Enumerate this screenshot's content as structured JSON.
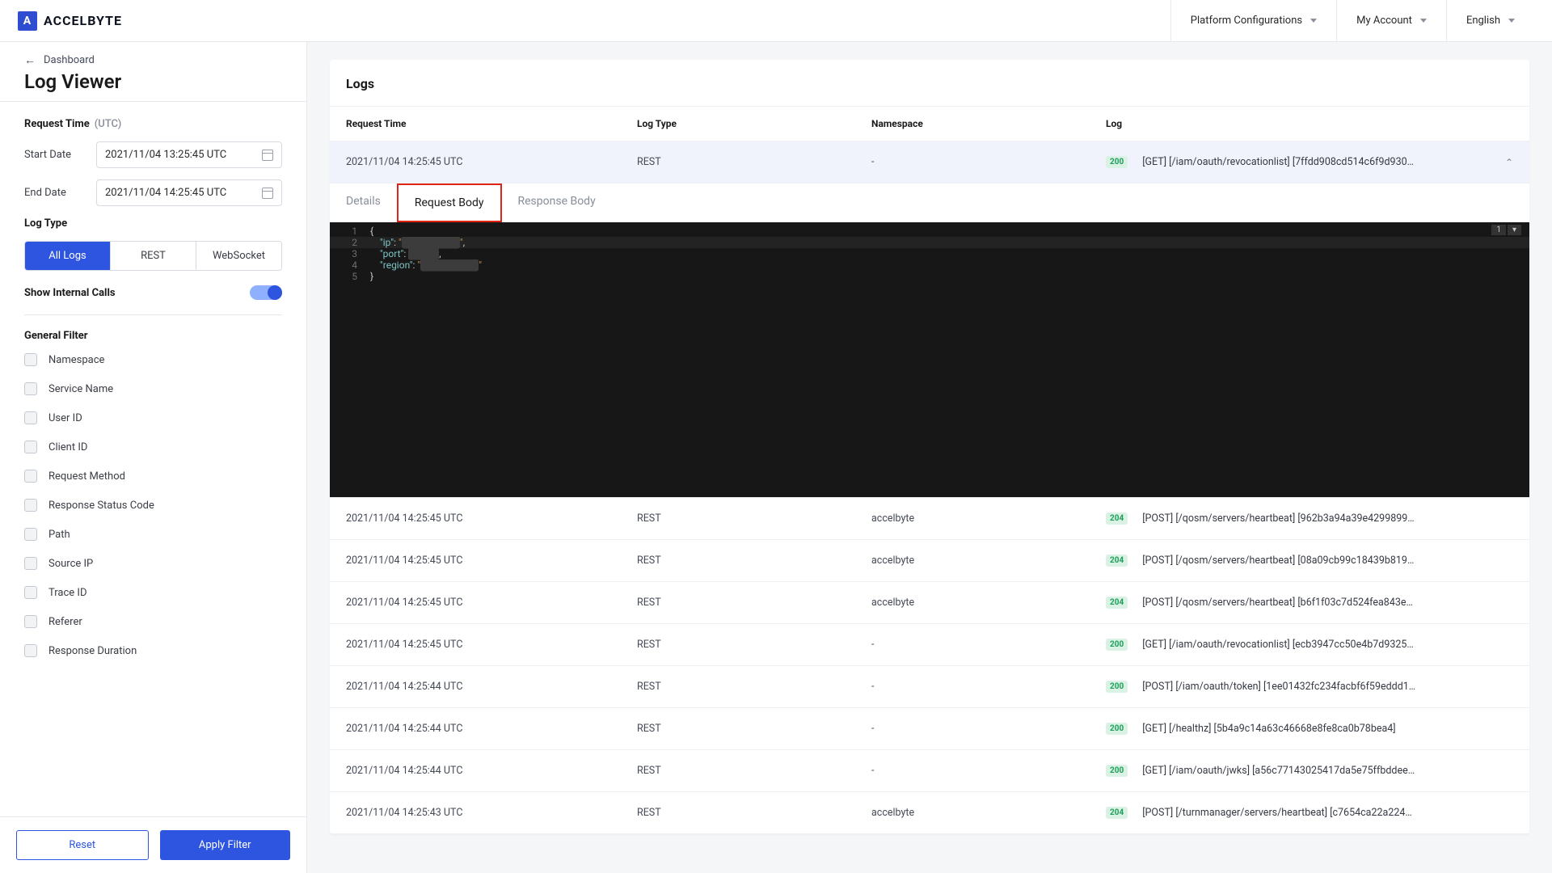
{
  "header": {
    "brand": "ACCELBYTE",
    "platform_config": "Platform Configurations",
    "my_account": "My Account",
    "language": "English"
  },
  "sidebar": {
    "breadcrumb_label": "Dashboard",
    "page_title": "Log Viewer",
    "request_time_label": "Request Time",
    "utc_label": "(UTC)",
    "start_date_label": "Start Date",
    "start_date_value": "2021/11/04 13:25:45 UTC",
    "end_date_label": "End Date",
    "end_date_value": "2021/11/04 14:25:45 UTC",
    "log_type_label": "Log Type",
    "seg_all": "All Logs",
    "seg_rest": "REST",
    "seg_ws": "WebSocket",
    "show_internal_label": "Show Internal Calls",
    "general_filter_label": "General Filter",
    "filters": [
      "Namespace",
      "Service Name",
      "User ID",
      "Client ID",
      "Request Method",
      "Response Status Code",
      "Path",
      "Source IP",
      "Trace ID",
      "Referer",
      "Response Duration"
    ],
    "reset_btn": "Reset",
    "apply_btn": "Apply Filter"
  },
  "table": {
    "title": "Logs",
    "cols": {
      "time": "Request Time",
      "type": "Log Type",
      "ns": "Namespace",
      "log": "Log"
    },
    "rows": [
      {
        "time": "2021/11/04 14:25:45 UTC",
        "type": "REST",
        "ns": "-",
        "status": "200",
        "log": "[GET] [/iam/oauth/revocationlist] [7ffdd908cd514c6f9d930…",
        "expanded": true
      },
      {
        "time": "2021/11/04 14:25:45 UTC",
        "type": "REST",
        "ns": "accelbyte",
        "status": "204",
        "log": "[POST] [/qosm/servers/heartbeat] [962b3a94a39e4299899…"
      },
      {
        "time": "2021/11/04 14:25:45 UTC",
        "type": "REST",
        "ns": "accelbyte",
        "status": "204",
        "log": "[POST] [/qosm/servers/heartbeat] [08a09cb99c18439b819…"
      },
      {
        "time": "2021/11/04 14:25:45 UTC",
        "type": "REST",
        "ns": "accelbyte",
        "status": "204",
        "log": "[POST] [/qosm/servers/heartbeat] [b6f1f03c7d524fea843e…"
      },
      {
        "time": "2021/11/04 14:25:45 UTC",
        "type": "REST",
        "ns": "-",
        "status": "200",
        "log": "[GET] [/iam/oauth/revocationlist] [ecb3947cc50e4b7d9325…"
      },
      {
        "time": "2021/11/04 14:25:44 UTC",
        "type": "REST",
        "ns": "-",
        "status": "200",
        "log": "[POST] [/iam/oauth/token] [1ee01432fc234facbf6f59eddd1…"
      },
      {
        "time": "2021/11/04 14:25:44 UTC",
        "type": "REST",
        "ns": "-",
        "status": "200",
        "log": "[GET] [/healthz] [5b4a9c14a63c46668e8fe8ca0b78bea4]"
      },
      {
        "time": "2021/11/04 14:25:44 UTC",
        "type": "REST",
        "ns": "-",
        "status": "200",
        "log": "[GET] [/iam/oauth/jwks] [a56c77143025417da5e75ffbddee…"
      },
      {
        "time": "2021/11/04 14:25:43 UTC",
        "type": "REST",
        "ns": "accelbyte",
        "status": "204",
        "log": "[POST] [/turnmanager/servers/heartbeat] [c7654ca22a224…"
      }
    ]
  },
  "detail": {
    "tabs": {
      "details": "Details",
      "req": "Request Body",
      "res": "Response Body"
    },
    "code": {
      "l1": "{",
      "l2_k": "\"ip\"",
      "l2_v": "████████",
      "l3_k": "\"port\"",
      "l3_v": "████",
      "l4_k": "\"region\"",
      "l4_v": "████████",
      "l5": "}"
    }
  }
}
